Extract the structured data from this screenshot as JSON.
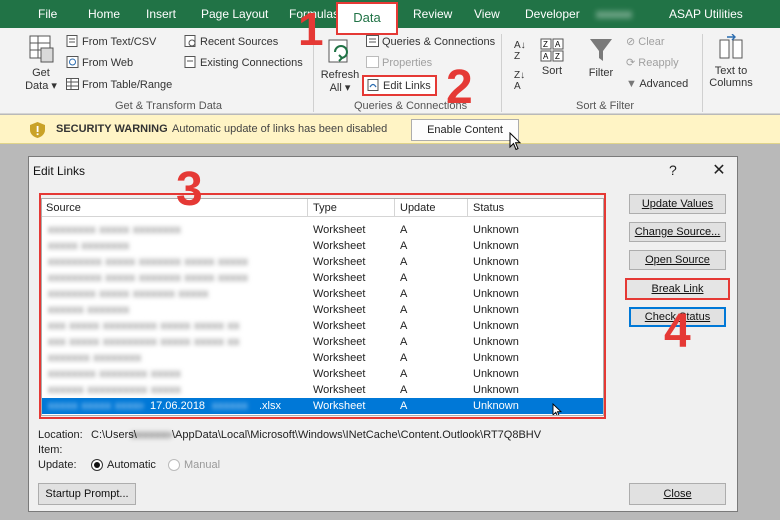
{
  "tabs": [
    {
      "label": "File"
    },
    {
      "label": "Home"
    },
    {
      "label": "Insert"
    },
    {
      "label": "Page Layout"
    },
    {
      "label": "Formulas"
    },
    {
      "label": "Data"
    },
    {
      "label": "Review"
    },
    {
      "label": "View"
    },
    {
      "label": "Developer"
    },
    {
      "label": "ASAP Utilities"
    }
  ],
  "ribbon": {
    "get_data": {
      "label1": "Get",
      "label2": "Data"
    },
    "from_text_csv": "From Text/CSV",
    "from_web": "From Web",
    "from_table_range": "From Table/Range",
    "recent_sources": "Recent Sources",
    "existing_connections": "Existing Connections",
    "group_get_transform": "Get & Transform Data",
    "refresh_all": {
      "label1": "Refresh",
      "label2": "All"
    },
    "queries_connections": "Queries & Connections",
    "properties": "Properties",
    "edit_links": "Edit Links",
    "group_queries": "Queries & Connections",
    "sort": "Sort",
    "filter": "Filter",
    "clear": "Clear",
    "reapply": "Reapply",
    "advanced": "Advanced",
    "group_sort_filter": "Sort & Filter",
    "text_to_columns": {
      "label1": "Text to",
      "label2": "Columns"
    }
  },
  "security_bar": {
    "title": "SECURITY WARNING",
    "message": "Automatic update of links has been disabled",
    "button": "Enable Content"
  },
  "dialog": {
    "title": "Edit Links",
    "help": "?",
    "close": "✕",
    "columns": [
      "Source",
      "Type",
      "Update",
      "Status"
    ],
    "rows": [
      {
        "source": "xxxxxxxx xxxxx xxxxxxxx",
        "type": "Worksheet",
        "update": "A",
        "status": "Unknown"
      },
      {
        "source": "xxxxx xxxxxxxx",
        "type": "Worksheet",
        "update": "A",
        "status": "Unknown"
      },
      {
        "source": "xxxxxxxxx xxxxx xxxxxxx xxxxx xxxxx",
        "type": "Worksheet",
        "update": "A",
        "status": "Unknown"
      },
      {
        "source": "xxxxxxxxx xxxxx xxxxxxx xxxxx xxxxx",
        "type": "Worksheet",
        "update": "A",
        "status": "Unknown"
      },
      {
        "source": "xxxxxxxx xxxxx xxxxxxx xxxxx",
        "type": "Worksheet",
        "update": "A",
        "status": "Unknown"
      },
      {
        "source": "xxxxxx xxxxxxx",
        "type": "Worksheet",
        "update": "A",
        "status": "Unknown"
      },
      {
        "source": "xxx xxxxx xxxxxxxxx xxxxx xxxxx xx",
        "type": "Worksheet",
        "update": "A",
        "status": "Unknown"
      },
      {
        "source": "xxx xxxxx xxxxxxxxx xxxxx xxxxx xx",
        "type": "Worksheet",
        "update": "A",
        "status": "Unknown"
      },
      {
        "source": "xxxxxxx xxxxxxxx",
        "type": "Worksheet",
        "update": "A",
        "status": "Unknown"
      },
      {
        "source": "xxxxxxxx xxxxxxxx xxxxx",
        "type": "Worksheet",
        "update": "A",
        "status": "Unknown"
      },
      {
        "source": "xxxxxx xxxxxxxxxx xxxxx",
        "type": "Worksheet",
        "update": "A",
        "status": "Unknown"
      }
    ],
    "selected_row": {
      "source_prefix_hidden": "xxxxx xxxxx xxxxx",
      "source_visible": "17.06.2018",
      "source_suffix_hidden": "xxxxxx",
      "source_ext": ".xlsx",
      "type": "Worksheet",
      "update": "A",
      "status": "Unknown"
    },
    "buttons": {
      "update_values": "Update Values",
      "change_source": "Change Source...",
      "open_source": "Open Source",
      "break_link": "Break Link",
      "check_status": "Check Status",
      "startup_prompt": "Startup Prompt...",
      "close": "Close"
    },
    "location_label": "Location:",
    "location_prefix": "C:\\Users\\",
    "location_hidden": "xxxxxxx",
    "location_suffix": "\\AppData\\Local\\Microsoft\\Windows\\INetCache\\Content.Outlook\\RT7Q8BHV",
    "item_label": "Item:",
    "update_label": "Update:",
    "automatic": "Automatic",
    "manual": "Manual"
  },
  "annotations": [
    "1",
    "2",
    "3",
    "4"
  ],
  "colors": {
    "excel_green": "#217346",
    "annotation_red": "#e53935",
    "selection_blue": "#0078d7"
  }
}
